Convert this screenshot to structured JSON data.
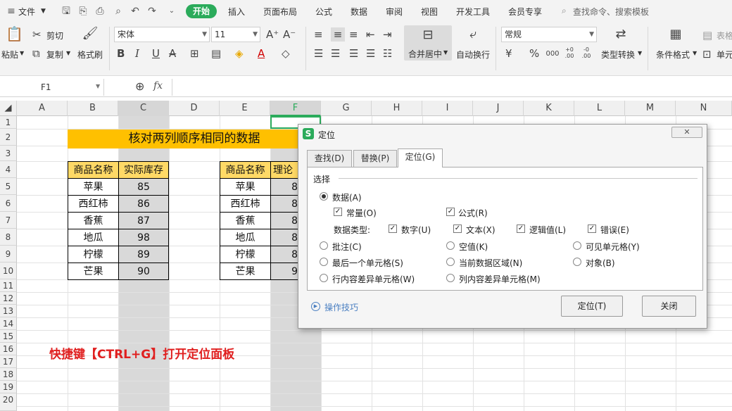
{
  "menubar": {
    "file": "文件",
    "tabs": [
      "开始",
      "插入",
      "页面布局",
      "公式",
      "数据",
      "审阅",
      "视图",
      "开发工具",
      "会员专享"
    ],
    "search_placeholder": "查找命令、搜索模板"
  },
  "ribbon": {
    "paste": "粘贴",
    "cut": "剪切",
    "copy": "复制",
    "format_painter": "格式刷",
    "font_name": "宋体",
    "font_size": "11",
    "merge_center": "合并居中",
    "wrap_text": "自动换行",
    "number_format": "常规",
    "type_convert": "类型转换",
    "cond_format": "条件格式",
    "table_style": "表格",
    "cell": "单元",
    "bold": "B",
    "italic": "I",
    "underline": "U",
    "font_color_letter": "A",
    "currency": "¥",
    "percent": "%",
    "thousands": "000",
    "inc_decimal": "+0 .00",
    "dec_decimal": "-0 .00"
  },
  "formula_bar": {
    "name_box": "F1",
    "fx": "fx",
    "value": ""
  },
  "columns": [
    "A",
    "B",
    "C",
    "D",
    "E",
    "F",
    "G",
    "H",
    "I",
    "J",
    "K",
    "L",
    "M",
    "N"
  ],
  "rows": [
    "1",
    "2",
    "3",
    "4",
    "5",
    "6",
    "7",
    "8",
    "9",
    "10",
    "11",
    "12",
    "13",
    "14",
    "15",
    "16",
    "17",
    "18",
    "19",
    "20"
  ],
  "sheet": {
    "title": "核对两列顺序相同的数据",
    "table1": {
      "headers": [
        "商品名称",
        "实际库存"
      ],
      "rows": [
        [
          "苹果",
          "85"
        ],
        [
          "西红柿",
          "86"
        ],
        [
          "香蕉",
          "87"
        ],
        [
          "地瓜",
          "98"
        ],
        [
          "柠檬",
          "89"
        ],
        [
          "芒果",
          "90"
        ]
      ]
    },
    "table2": {
      "headers": [
        "商品名称",
        "理论"
      ],
      "rows": [
        [
          "苹果",
          "8"
        ],
        [
          "西红柿",
          "8"
        ],
        [
          "香蕉",
          "8"
        ],
        [
          "地瓜",
          "8"
        ],
        [
          "柠檬",
          "8"
        ],
        [
          "芒果",
          "9"
        ]
      ]
    },
    "note": "快捷键【CTRL+G】打开定位面板"
  },
  "dialog": {
    "title": "定位",
    "tabs": [
      "查找(D)",
      "替换(P)",
      "定位(G)"
    ],
    "group_label": "选择",
    "data": "数据(A)",
    "constants": "常量(O)",
    "formulas": "公式(R)",
    "data_type_label": "数据类型:",
    "number": "数字(U)",
    "text": "文本(X)",
    "logical": "逻辑值(L)",
    "error": "错误(E)",
    "comments": "批注(C)",
    "blanks": "空值(K)",
    "visible_cells": "可见单元格(Y)",
    "last_cell": "最后一个单元格(S)",
    "current_region": "当前数据区域(N)",
    "objects": "对象(B)",
    "row_diff": "行内容差异单元格(W)",
    "col_diff": "列内容差异单元格(M)",
    "tips": "操作技巧",
    "locate_button": "定位(T)",
    "close_button": "关闭"
  },
  "colors": {
    "accent": "#2bab5b",
    "title_fill": "#ffc000",
    "header_fill": "#ffd966",
    "selected_column": "#d9d9d9",
    "note_text": "#e02020"
  }
}
